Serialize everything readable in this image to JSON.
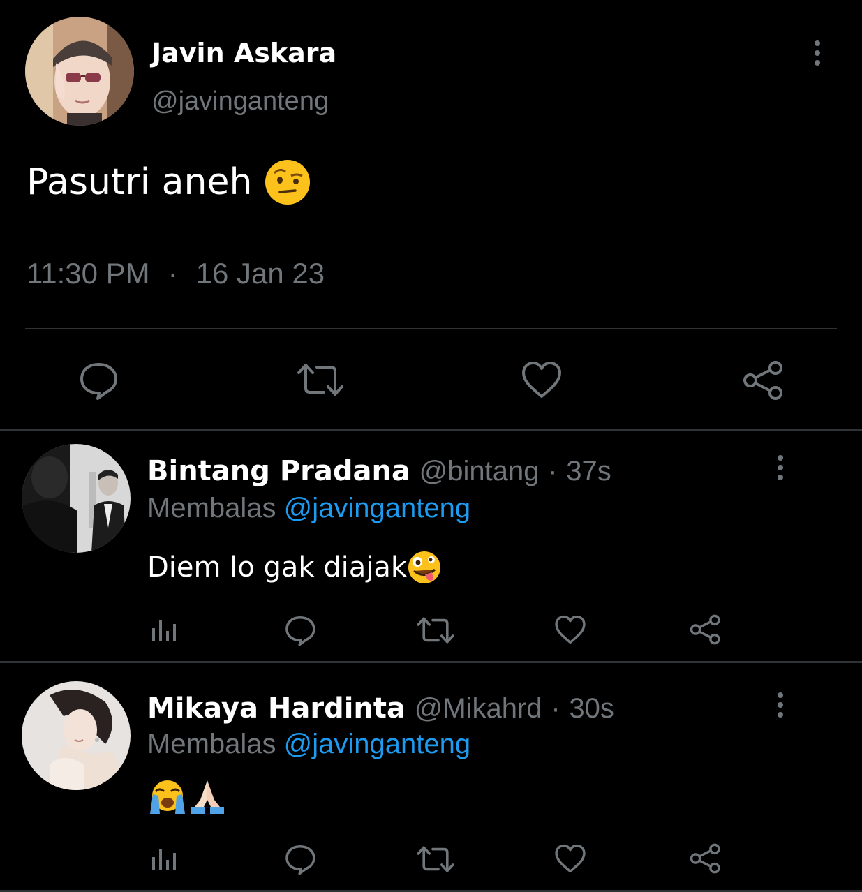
{
  "main_tweet": {
    "display_name": "Javin Askara",
    "handle": "@javinganteng",
    "text": "Pasutri aneh",
    "text_emoji": "raised-eyebrow-face",
    "time": "11:30 PM",
    "separator": "·",
    "date": "16 Jan 23",
    "actions": [
      "reply-icon",
      "retweet-icon",
      "like-icon",
      "share-icon"
    ]
  },
  "replies": [
    {
      "display_name": "Bintang Pradana",
      "handle": "@bintang",
      "separator": "·",
      "time": "37s",
      "replying_label": "Membalas",
      "replying_to": "@javinganteng",
      "text": "Diem lo gak diajak",
      "text_emoji": "zany-face",
      "actions": [
        "views-icon",
        "reply-icon",
        "retweet-icon",
        "like-icon",
        "share-icon"
      ]
    },
    {
      "display_name": "Mikaya Hardinta",
      "handle": "@Mikahrd",
      "separator": "·",
      "time": "30s",
      "replying_label": "Membalas",
      "replying_to": "@javinganteng",
      "text": "",
      "text_emoji": "loudly-crying-face folded-hands",
      "actions": [
        "views-icon",
        "reply-icon",
        "retweet-icon",
        "like-icon",
        "share-icon"
      ]
    }
  ],
  "colors": {
    "background": "#000000",
    "secondary_text": "#71767b",
    "mention": "#1d9bf0",
    "divider": "#2f3336"
  }
}
